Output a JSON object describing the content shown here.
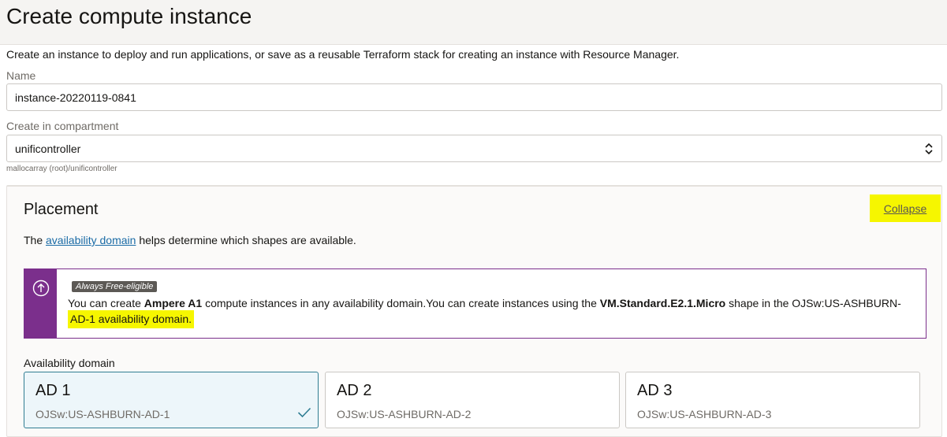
{
  "header": {
    "title": "Create compute instance"
  },
  "intro": "Create an instance to deploy and run applications, or save as a reusable Terraform stack for creating an instance with Resource Manager.",
  "name_field": {
    "label": "Name",
    "value": "instance-20220119-0841"
  },
  "compartment": {
    "label": "Create in compartment",
    "value": "unificontroller",
    "path": "mallocarray (root)/unificontroller"
  },
  "placement": {
    "title": "Placement",
    "collapse_label": "Collapse",
    "desc_prefix": "The",
    "desc_link": "availability domain",
    "desc_suffix": "helps determine which shapes are available.",
    "notice": {
      "icon": "arrow-up-circle-icon",
      "badge": "Always Free-eligible",
      "t1": "You can create",
      "b1": "Ampere A1",
      "t2": "compute instances in any availability domain.You can create instances using the",
      "b2": "VM.Standard.E2.1.Micro",
      "t3": "shape in the OJSw:US-ASHBURN-",
      "t4": "AD-1 availability domain."
    },
    "ad_label": "Availability domain",
    "domains": [
      {
        "name": "AD 1",
        "sub": "OJSw:US-ASHBURN-AD-1",
        "selected": true
      },
      {
        "name": "AD 2",
        "sub": "OJSw:US-ASHBURN-AD-2",
        "selected": false
      },
      {
        "name": "AD 3",
        "sub": "OJSw:US-ASHBURN-AD-3",
        "selected": false
      }
    ]
  },
  "colors": {
    "accent_purple": "#7b2f8c",
    "highlight": "#f6f600",
    "link": "#1a6ba6",
    "selected_border": "#2f7d93"
  }
}
